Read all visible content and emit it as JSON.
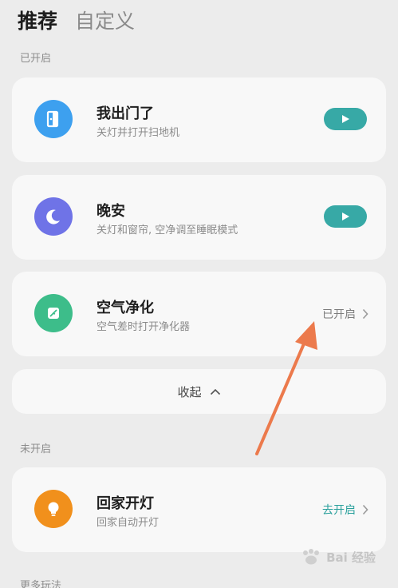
{
  "tabs": [
    {
      "label": "推荐",
      "active": true
    },
    {
      "label": "自定义",
      "active": false
    }
  ],
  "sections": {
    "enabled_label": "已开启",
    "disabled_label": "未开启",
    "more_label": "更多玩法"
  },
  "scenes": [
    {
      "title": "我出门了",
      "subtitle": "关灯并打开扫地机",
      "icon": "door-exit-icon",
      "icon_color": "#3da0ef",
      "action": "play"
    },
    {
      "title": "晚安",
      "subtitle": "关灯和窗帘, 空净调至睡眠模式",
      "icon": "moon-icon",
      "icon_color": "#6f73e7",
      "action": "play"
    },
    {
      "title": "空气净化",
      "subtitle": "空气差时打开净化器",
      "icon": "leaf-icon",
      "icon_color": "#3dbd8a",
      "status": "已开启"
    },
    {
      "title": "回家开灯",
      "subtitle": "回家自动开灯",
      "icon": "lightbulb-icon",
      "icon_color": "#f1901c",
      "status": "去开启"
    }
  ],
  "collapse": {
    "label": "收起"
  },
  "colors": {
    "accent_teal": "#37a9a6",
    "annotation_arrow": "#ec7a4c"
  },
  "watermark": {
    "text": "Bai 经验",
    "icon": "baidu-paw-icon"
  }
}
